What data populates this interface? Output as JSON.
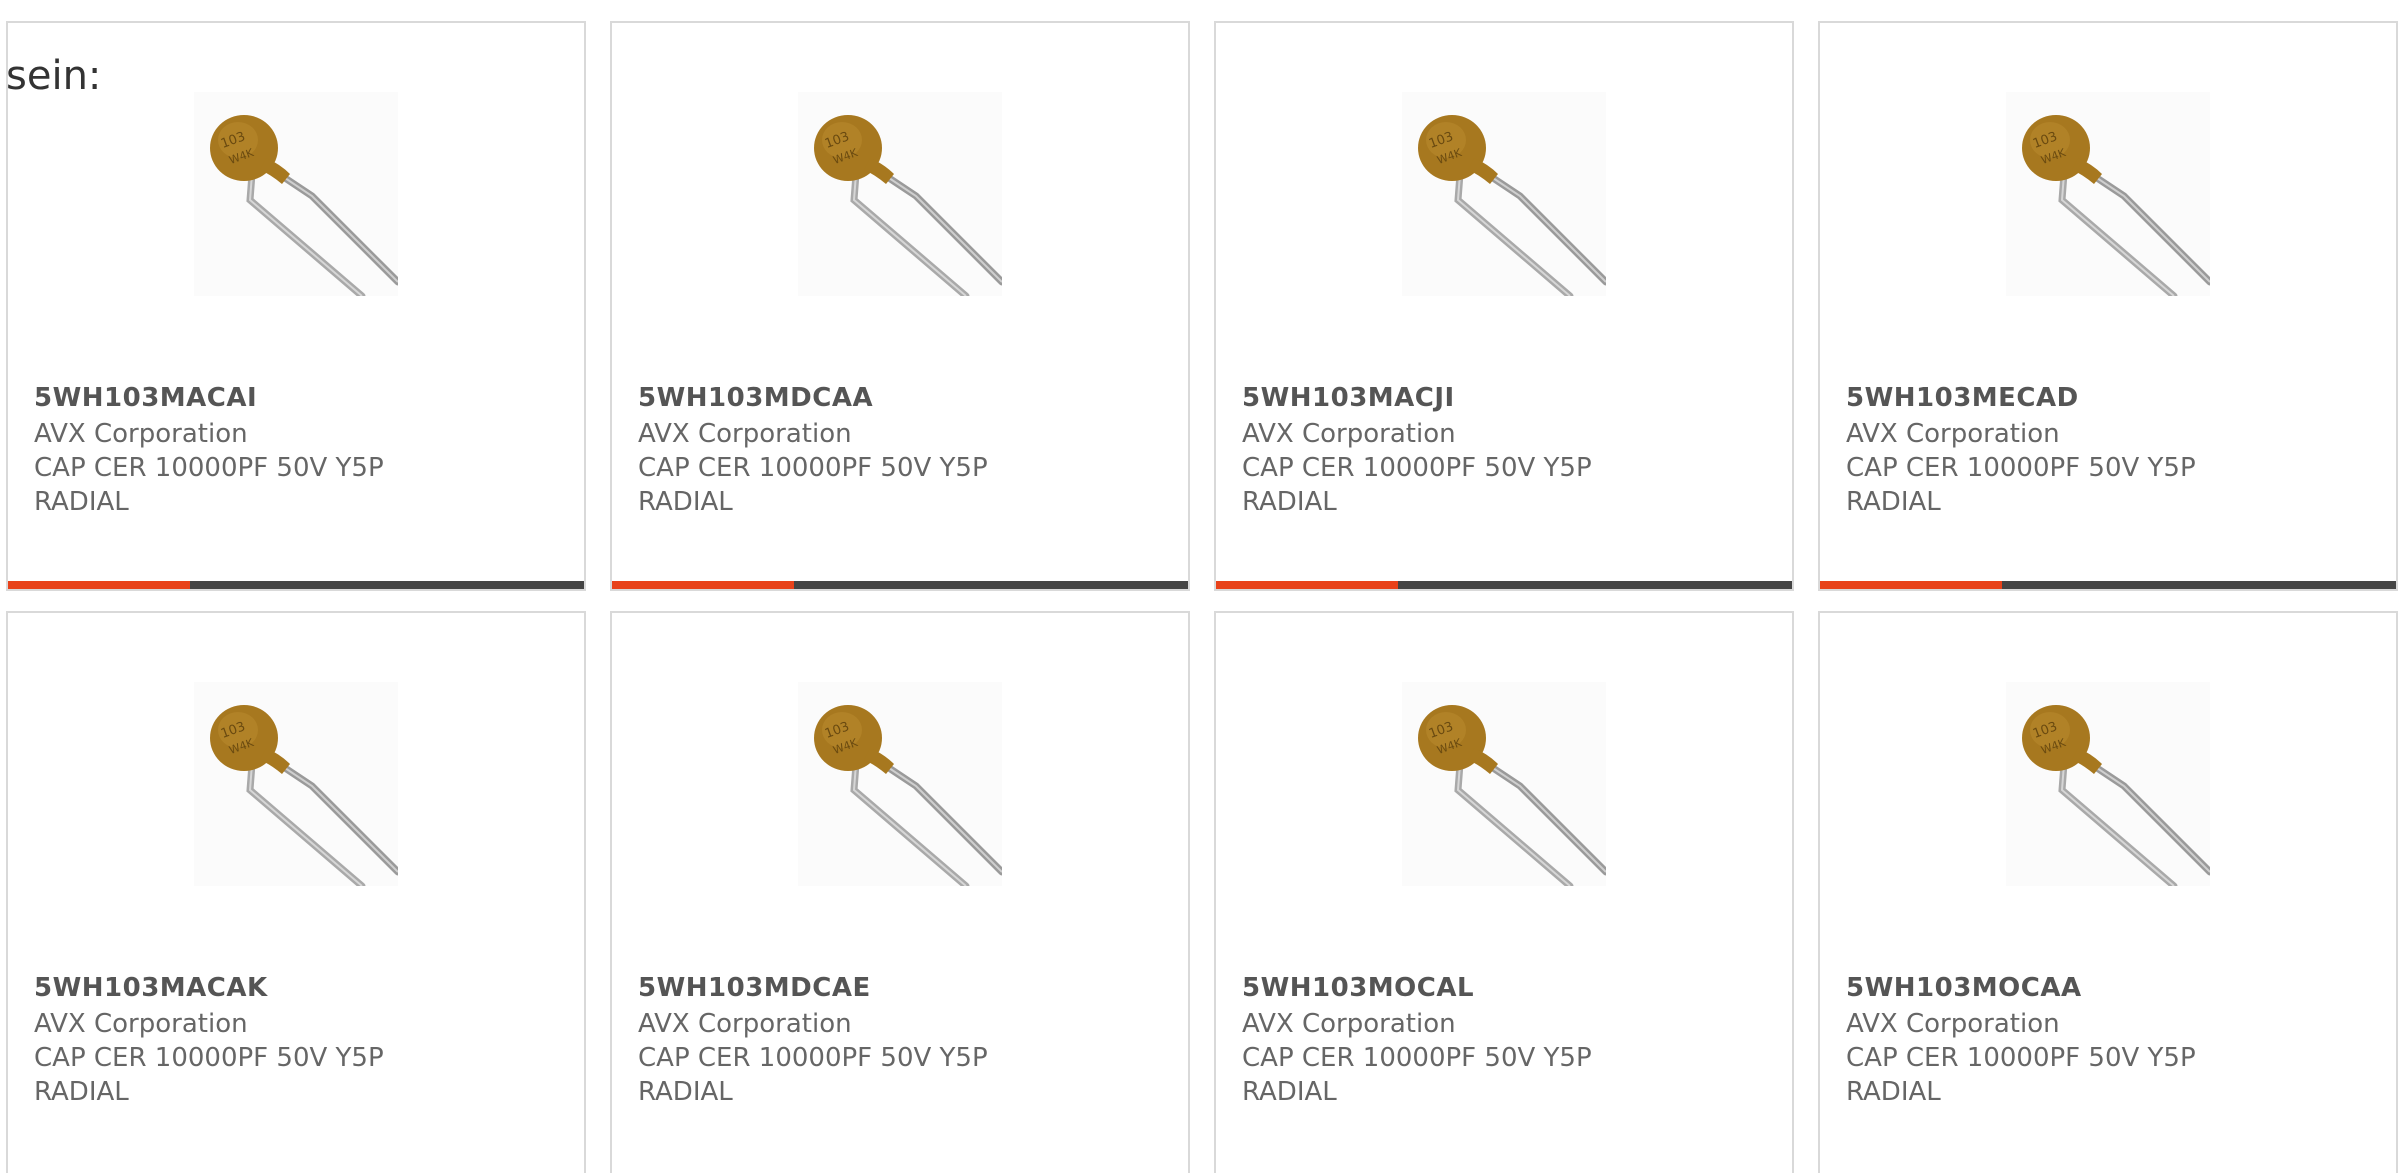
{
  "intro_text": "sein:",
  "colors": {
    "accent": "#e8421a",
    "bar": "#444444",
    "border": "#d9d9d9",
    "text": "#666666"
  },
  "products": [
    {
      "part": "5WH103MACAI",
      "manufacturer": "AVX Corporation",
      "description": "CAP CER 10000PF 50V Y5P RADIAL",
      "image": "ceramic-disc-capacitor-image"
    },
    {
      "part": "5WH103MDCAA",
      "manufacturer": "AVX Corporation",
      "description": "CAP CER 10000PF 50V Y5P RADIAL",
      "image": "ceramic-disc-capacitor-image"
    },
    {
      "part": "5WH103MACJI",
      "manufacturer": "AVX Corporation",
      "description": "CAP CER 10000PF 50V Y5P RADIAL",
      "image": "ceramic-disc-capacitor-image"
    },
    {
      "part": "5WH103MECAD",
      "manufacturer": "AVX Corporation",
      "description": "CAP CER 10000PF 50V Y5P RADIAL",
      "image": "ceramic-disc-capacitor-image"
    },
    {
      "part": "5WH103MACAK",
      "manufacturer": "AVX Corporation",
      "description": "CAP CER 10000PF 50V Y5P RADIAL",
      "image": "ceramic-disc-capacitor-image"
    },
    {
      "part": "5WH103MDCAE",
      "manufacturer": "AVX Corporation",
      "description": "CAP CER 10000PF 50V Y5P RADIAL",
      "image": "ceramic-disc-capacitor-image"
    },
    {
      "part": "5WH103MOCAL",
      "manufacturer": "AVX Corporation",
      "description": "CAP CER 10000PF 50V Y5P RADIAL",
      "image": "ceramic-disc-capacitor-image"
    },
    {
      "part": "5WH103MOCAA",
      "manufacturer": "AVX Corporation",
      "description": "CAP CER 10000PF 50V Y5P RADIAL",
      "image": "ceramic-disc-capacitor-image"
    }
  ]
}
